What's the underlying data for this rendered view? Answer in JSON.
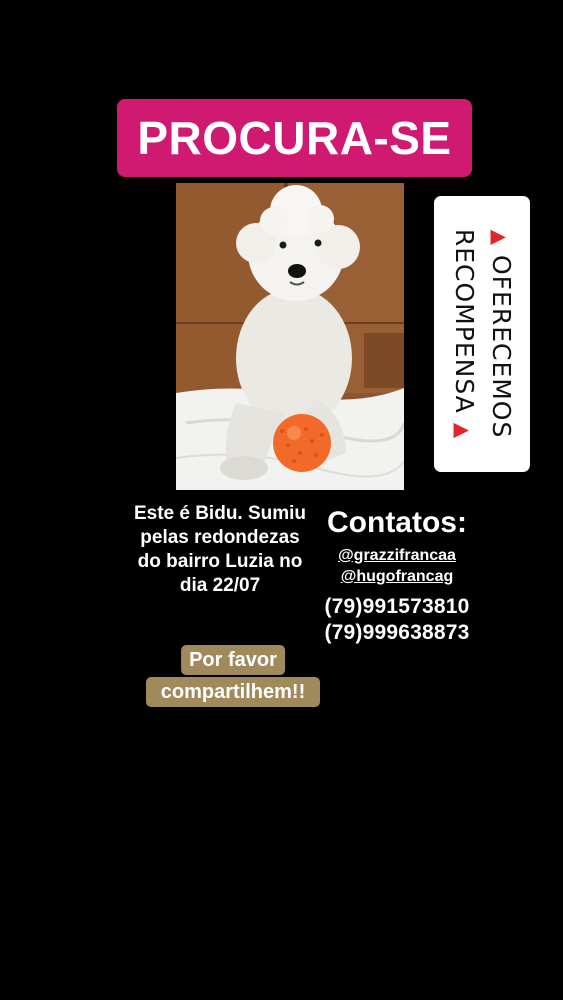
{
  "title": "PROCURA-SE",
  "reward": {
    "line1": "OFERECEMOS",
    "line2": "RECOMPENSA",
    "marker": "▲",
    "marker_color": "#e1262b"
  },
  "description": "Este é Bidu. Sumiu pelas redondezas do bairro Luzia no dia 22/07",
  "share": {
    "line1": "Por favor",
    "line2": "compartilhem!!"
  },
  "contacts": {
    "title": "Contatos:",
    "handles": [
      "@grazzifrancaa",
      "@hugofrancag"
    ],
    "phones": [
      "(79)991573810",
      "(79)999638873"
    ]
  },
  "colors": {
    "background": "#000000",
    "title_banner": "#d01970",
    "share_highlight": "#a08a5c",
    "reward_card": "#ffffff"
  },
  "photo": {
    "subject": "white poodle with orange ball",
    "icon": "dog-photo"
  }
}
